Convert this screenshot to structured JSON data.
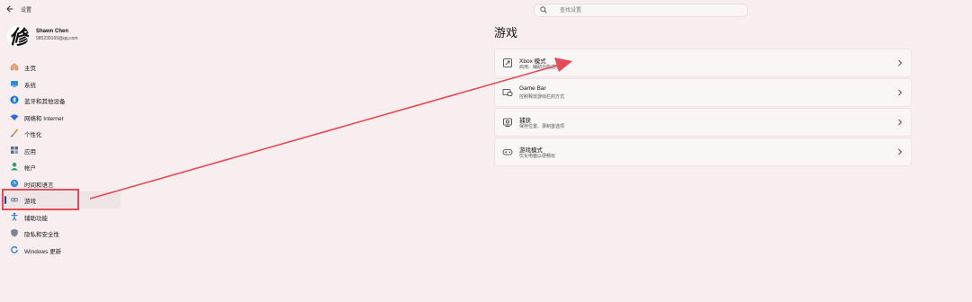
{
  "window": {
    "title": "设置"
  },
  "search": {
    "placeholder": "查找设置"
  },
  "profile": {
    "avatar_char": "修",
    "name": "Shawn Chen",
    "email": "985239165@qq.com"
  },
  "sidebar": {
    "items": [
      {
        "label": "主页",
        "icon": "home-icon"
      },
      {
        "label": "系统",
        "icon": "system-icon"
      },
      {
        "label": "蓝牙和其他设备",
        "icon": "bluetooth-icon"
      },
      {
        "label": "网络和 Internet",
        "icon": "wifi-icon"
      },
      {
        "label": "个性化",
        "icon": "brush-icon"
      },
      {
        "label": "应用",
        "icon": "apps-icon"
      },
      {
        "label": "帐户",
        "icon": "account-icon"
      },
      {
        "label": "时间和语言",
        "icon": "globe-clock-icon"
      },
      {
        "label": "游戏",
        "icon": "gamepad-icon",
        "active": true
      },
      {
        "label": "辅助功能",
        "icon": "accessibility-icon"
      },
      {
        "label": "隐私和安全性",
        "icon": "shield-icon"
      },
      {
        "label": "Windows 更新",
        "icon": "update-icon"
      }
    ]
  },
  "main": {
    "title": "游戏",
    "cards": [
      {
        "title": "Xbox 模式",
        "subtitle": "启用、辅助功能选项",
        "icon": "xbox-mode-icon"
      },
      {
        "title": "Game Bar",
        "subtitle": "控制释放游戏栏的方式",
        "icon": "game-bar-icon"
      },
      {
        "title": "捕获",
        "subtitle": "保存位置、录制首选项",
        "icon": "capture-icon"
      },
      {
        "title": "游戏模式",
        "subtitle": "优化电脑以便畅玩",
        "icon": "game-mode-icon"
      }
    ]
  },
  "colors": {
    "accent": "#1f3fae",
    "annotation": "#e64a55",
    "background": "#f8eeef",
    "card": "#fbf6f6"
  }
}
